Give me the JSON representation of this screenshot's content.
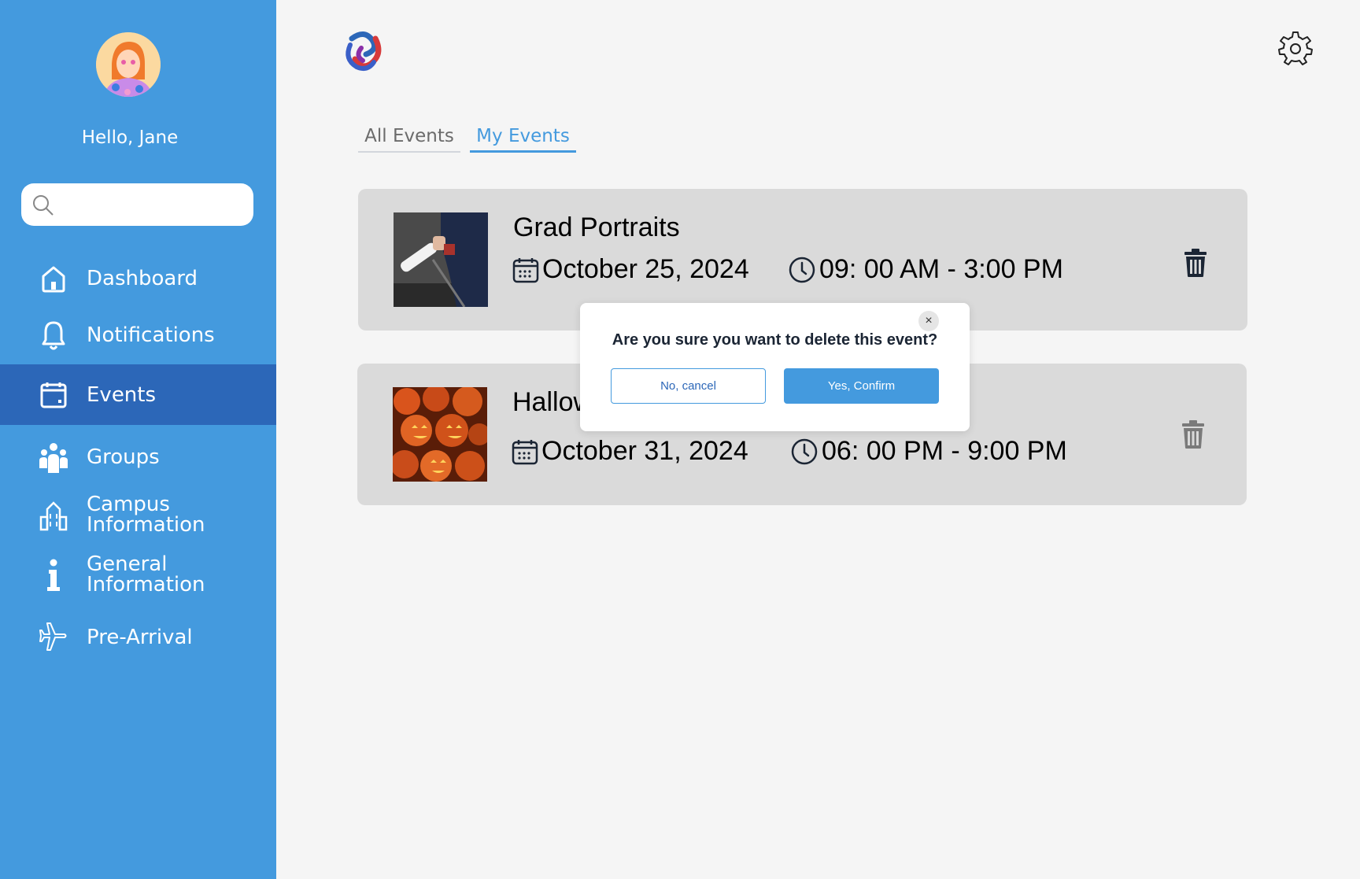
{
  "sidebar": {
    "greeting": "Hello, Jane",
    "search_placeholder": "",
    "items": [
      {
        "label": "Dashboard",
        "icon": "home-icon"
      },
      {
        "label": "Notifications",
        "icon": "bell-icon"
      },
      {
        "label": "Events",
        "icon": "calendar-icon",
        "active": true
      },
      {
        "label": "Groups",
        "icon": "people-icon"
      },
      {
        "label_line1": "Campus",
        "label_line2": "Information",
        "icon": "building-icon"
      },
      {
        "label_line1": "General",
        "label_line2": "Information",
        "icon": "info-icon"
      },
      {
        "label": "Pre-Arrival",
        "icon": "airplane-icon"
      }
    ]
  },
  "tabs": [
    {
      "label": "All Events"
    },
    {
      "label": "My Events",
      "active": true
    }
  ],
  "events": [
    {
      "title": "Grad Portraits",
      "date": "October 25, 2024",
      "time": "09: 00 AM - 3:00 PM"
    },
    {
      "title": "Hallow",
      "date": "October 31, 2024",
      "time": "06: 00 PM - 9:00 PM"
    }
  ],
  "modal": {
    "message": "Are you sure you want to delete this event?",
    "cancel_label": "No, cancel",
    "confirm_label": "Yes, Confirm",
    "close_symbol": "×"
  },
  "colors": {
    "sidebar": "#449ade",
    "sidebar_active": "#2c67b8",
    "accent": "#449ade"
  }
}
